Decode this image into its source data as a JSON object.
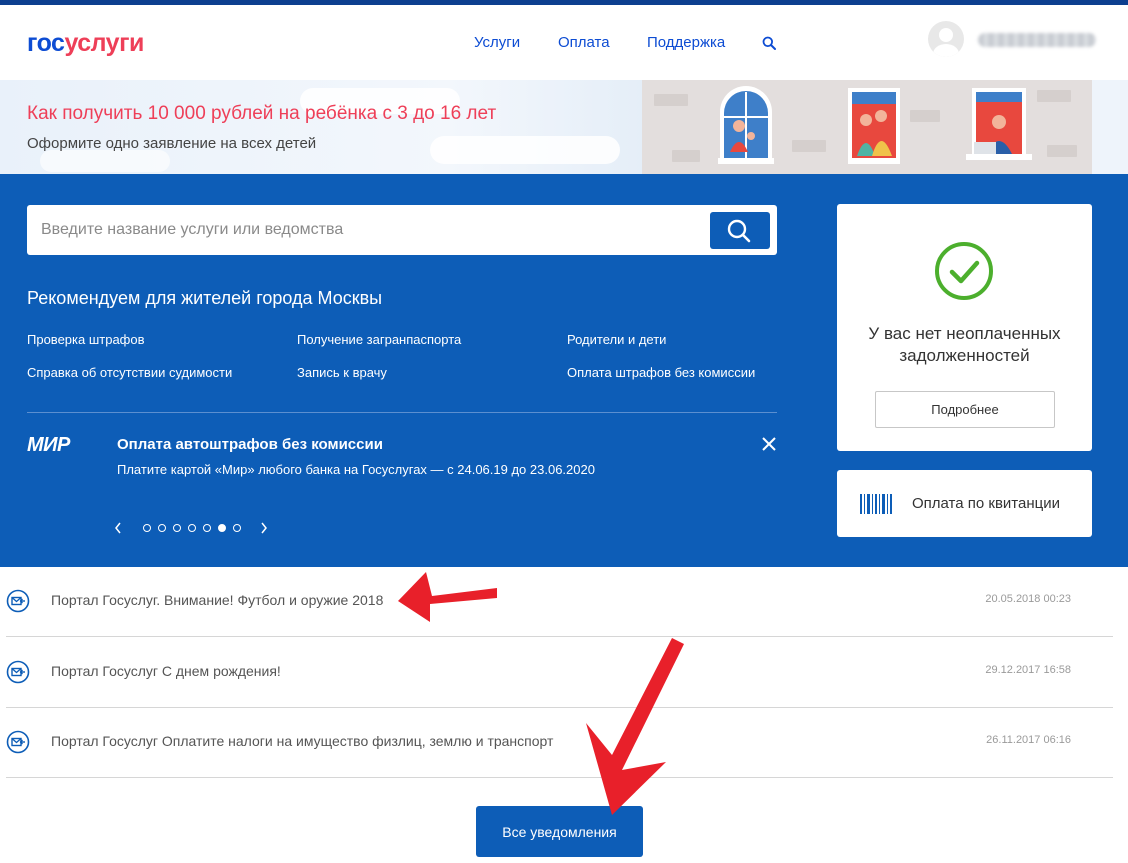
{
  "header": {
    "logo_gos": "гос",
    "logo_uslugi": "услуги",
    "nav": [
      "Услуги",
      "Оплата",
      "Поддержка"
    ]
  },
  "banner": {
    "title": "Как получить 10 000 рублей на ребёнка с 3 до 16 лет",
    "subtitle": "Оформите одно заявление на всех детей"
  },
  "search": {
    "placeholder": "Введите название услуги или ведомства"
  },
  "recommend": {
    "title": "Рекомендуем для жителей города Москвы",
    "links": [
      "Проверка штрафов",
      "Получение загранпаспорта",
      "Родители и дети",
      "Справка об отсутствии судимости",
      "Запись к врачу",
      "Оплата штрафов без комиссии"
    ]
  },
  "promo": {
    "logo": "МИР",
    "title": "Оплата автоштрафов без комиссии",
    "subtitle": "Платите картой «Мир» любого банка на Госуслугах — с 24.06.19 до 23.06.2020",
    "slides_total": 7,
    "active_slide": 6
  },
  "debt_card": {
    "text_line1": "У вас нет неоплаченных",
    "text_line2": "задолженностей",
    "button": "Подробнее"
  },
  "receipt_card": {
    "label": "Оплата по квитанции"
  },
  "notifications": [
    {
      "text": "Портал Госуслуг. Внимание! Футбол и оружие 2018",
      "date": "20.05.2018 00:23"
    },
    {
      "text": "Портал Госуслуг С днем рождения!",
      "date": "29.12.2017 16:58"
    },
    {
      "text": "Портал Госуслуг Оплатите налоги на имущество физлиц, землю и транспорт",
      "date": "26.11.2017 06:16"
    }
  ],
  "all_notifications_button": "Все уведомления",
  "colors": {
    "brand_blue": "#0d4cd3",
    "brand_red": "#ee3f58",
    "section_blue": "#0d5db7",
    "check_green": "#4caf2d",
    "annotation_red": "#e8202a"
  }
}
